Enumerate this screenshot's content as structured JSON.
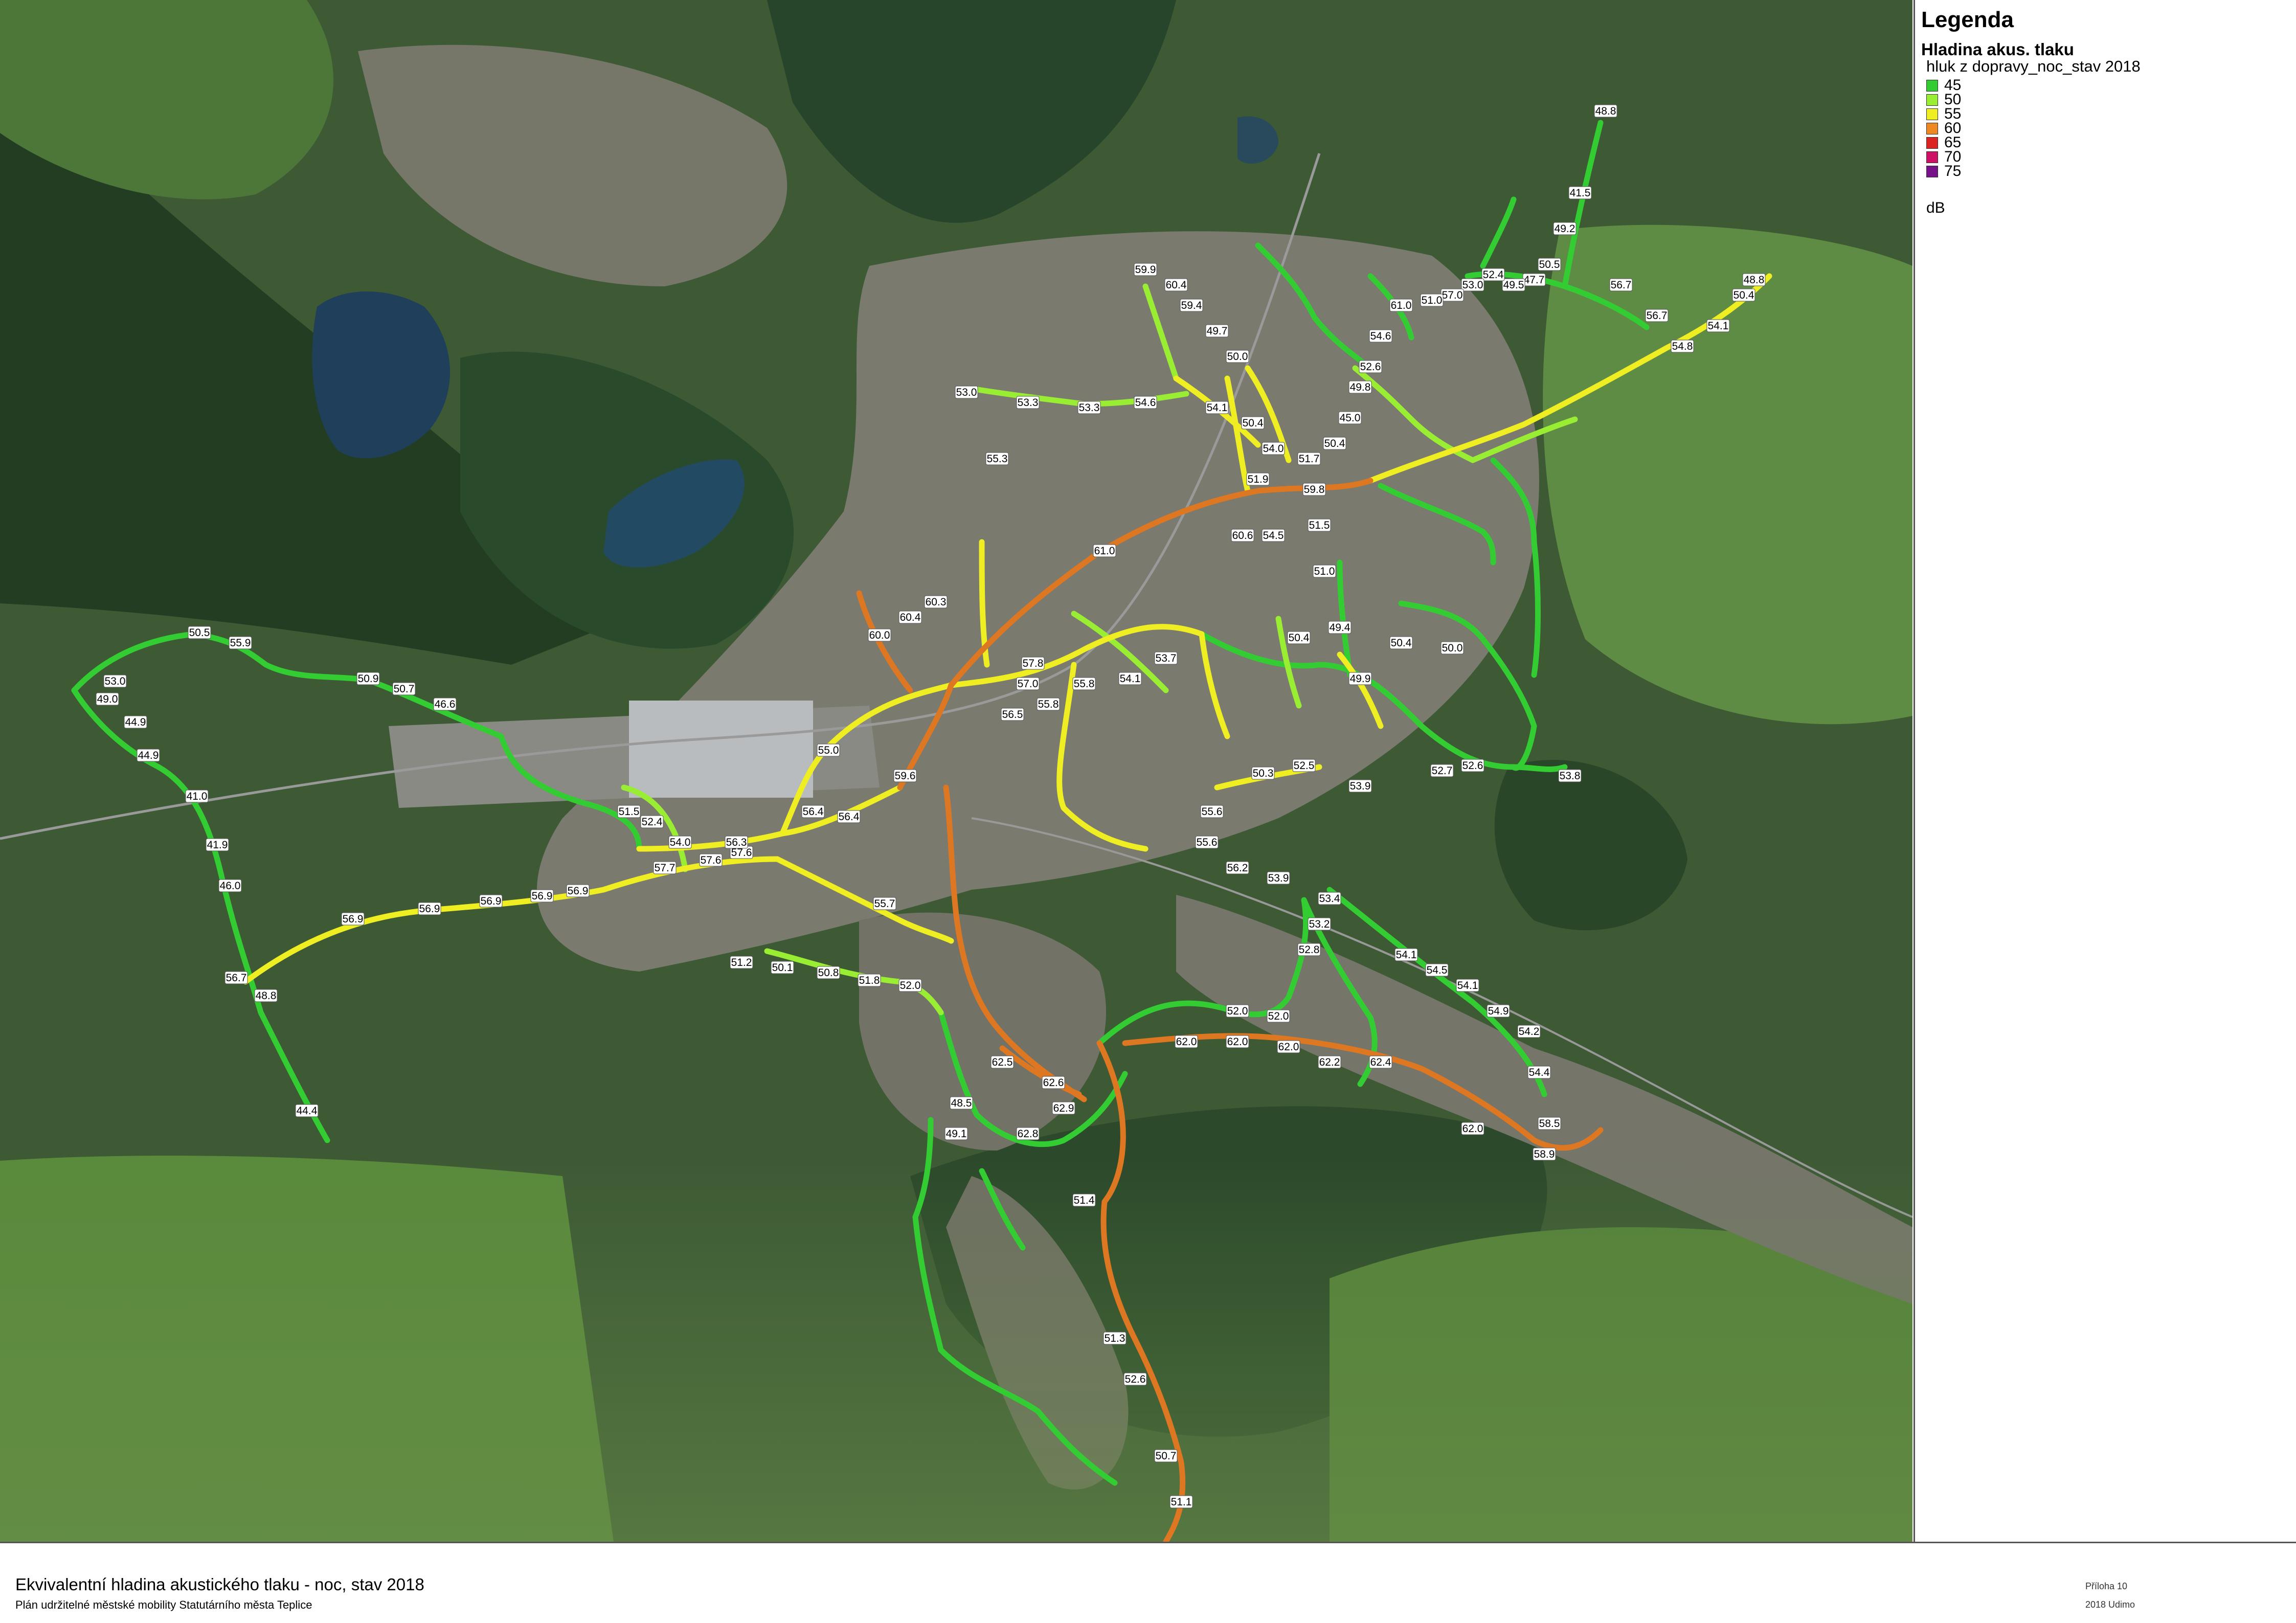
{
  "legend": {
    "title": "Legenda",
    "subtitle": "Hladina akus. tlaku",
    "layer_name": "hluk z dopravy_noc_stav 2018",
    "classes": [
      {
        "label": "45",
        "color": "#33cc33"
      },
      {
        "label": "50",
        "color": "#99ee33"
      },
      {
        "label": "55",
        "color": "#eeee22"
      },
      {
        "label": "60",
        "color": "#ee8822"
      },
      {
        "label": "65",
        "color": "#dd2222"
      },
      {
        "label": "70",
        "color": "#cc1166"
      },
      {
        "label": "75",
        "color": "#771188"
      }
    ],
    "unit": "dB"
  },
  "footer": {
    "title": "Ekvivalentní hladina akustického tlaku - noc, stav 2018",
    "subtitle": "Plán udržitelné městské mobility Statutárního města Teplice",
    "annex": "Příloha 10",
    "credit": "2018 Udimo"
  },
  "map": {
    "colors": {
      "green": "#33cc33",
      "lime": "#99ee33",
      "yellow": "#eeee22",
      "orange": "#dd7722",
      "water": "#1f3f5a",
      "urban": "#7d7d72",
      "forest": "#233f24",
      "field": "#5f8a3f"
    },
    "road_labels": [
      "50.7",
      "50.7",
      "50.7",
      "50.7",
      "50.7",
      "50.7",
      "49.0",
      "44.9",
      "44.9",
      "41.0",
      "41.9",
      "46.0",
      "56.7",
      "48.8",
      "44.4",
      "56.9",
      "56.9",
      "56.9",
      "56.9",
      "56.9",
      "57.7",
      "57.6",
      "57.6",
      "55.7",
      "51.2",
      "50.1",
      "50.8",
      "51.8",
      "52.0",
      "51.5",
      "52.4",
      "54.0",
      "56.3",
      "56.4",
      "56.4",
      "55.0",
      "59.6",
      "60.0",
      "60.4",
      "60.3",
      "61.0",
      "60.6",
      "59.8",
      "57.8",
      "57.0",
      "56.5",
      "55.8",
      "55.8",
      "54.1",
      "53.7",
      "53.0",
      "53.3",
      "53.3",
      "54.6",
      "54.1",
      "55.3",
      "51.9",
      "54.5",
      "51.5",
      "51.0",
      "50.4",
      "49.4",
      "49.9",
      "50.4",
      "50.0",
      "52.5",
      "53.9",
      "52.7",
      "52.6",
      "53.8",
      "50.3",
      "55.6",
      "55.6",
      "56.2",
      "53.9",
      "53.4",
      "53.2",
      "52.8",
      "52.0",
      "52.0",
      "62.0",
      "62.0",
      "62.0",
      "62.2",
      "62.4",
      "62.0",
      "62.5",
      "62.6",
      "62.9",
      "62.8",
      "48.5",
      "49.1",
      "51.4",
      "51.3",
      "52.6",
      "50.7",
      "51.1",
      "54.1",
      "54.5",
      "54.1",
      "54.9",
      "54.2",
      "54.4",
      "58.5",
      "58.9",
      "56.7",
      "56.7",
      "54.8",
      "54.1",
      "50.4",
      "48.8",
      "48.8",
      "41.5",
      "49.2",
      "50.5",
      "47.7",
      "49.5",
      "52.4",
      "53.0",
      "57.0",
      "51.0",
      "61.0",
      "54.6",
      "52.6",
      "49.8",
      "45.0",
      "50.4",
      "51.7",
      "54.0",
      "50.4",
      "50.0",
      "49.7",
      "59.4",
      "60.4",
      "59.9",
      "50.5",
      "55.9",
      "50.9",
      "50.7",
      "46.6",
      "53.0"
    ]
  }
}
